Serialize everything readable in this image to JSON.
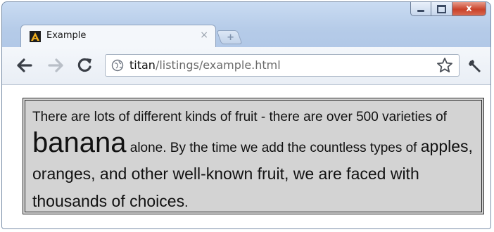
{
  "window": {
    "controls": {
      "minimize_glyph": "minimize",
      "maximize_glyph": "maximize",
      "close_label": "x"
    }
  },
  "tab": {
    "title": "Example",
    "close_label": "×",
    "favicon": "A"
  },
  "new_tab": {
    "label": "+"
  },
  "toolbar": {
    "back_icon": "back-arrow-icon",
    "forward_icon": "forward-arrow-icon",
    "reload_icon": "reload-icon",
    "url_host": "titan",
    "url_path": "/listings/example.html",
    "star_icon": "star-icon",
    "wrench_icon": "wrench-icon"
  },
  "content": {
    "text_1": "There are lots of different kinds of fruit - there are over 500 varieties of ",
    "big_word": "banana",
    "text_2": " alone. By the time we add the countless types of ",
    "larger_text": "apples, oranges, and other well-known fruit, we are faced with thousands of choices",
    "text_3": "."
  },
  "colors": {
    "box_background": "#d3d3d3",
    "box_border": "#2a2a2a",
    "close_button": "#c9422a"
  }
}
